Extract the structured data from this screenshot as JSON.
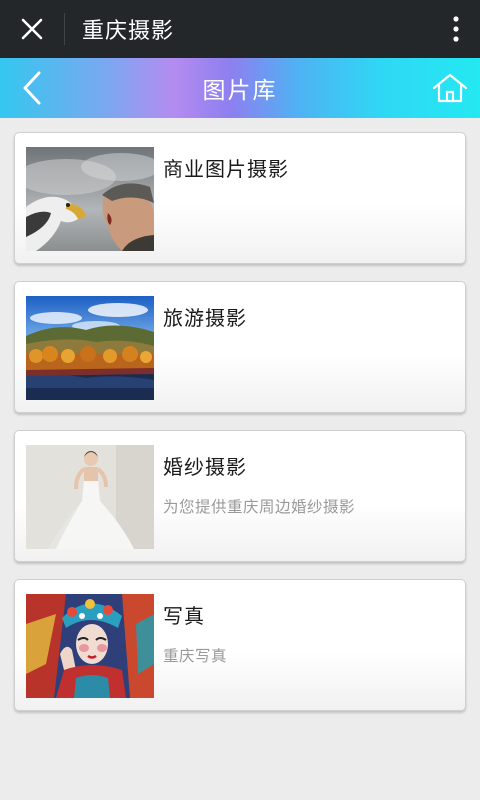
{
  "topbar": {
    "title": "重庆摄影"
  },
  "header": {
    "title": "图片库"
  },
  "items": [
    {
      "title": "商业图片摄影",
      "desc": ""
    },
    {
      "title": "旅游摄影",
      "desc": ""
    },
    {
      "title": "婚纱摄影",
      "desc": "为您提供重庆周边婚纱摄影"
    },
    {
      "title": "写真",
      "desc": "重庆写真"
    }
  ],
  "colors": {
    "topbar_bg": "#23272a",
    "page_bg": "#ececec",
    "header_gradient": [
      "#34c7ef",
      "#b48cf0",
      "#24e8f2"
    ]
  },
  "icons": {
    "close": "close-icon",
    "more": "more-vertical-icon",
    "back": "chevron-left-icon",
    "home": "home-icon"
  }
}
